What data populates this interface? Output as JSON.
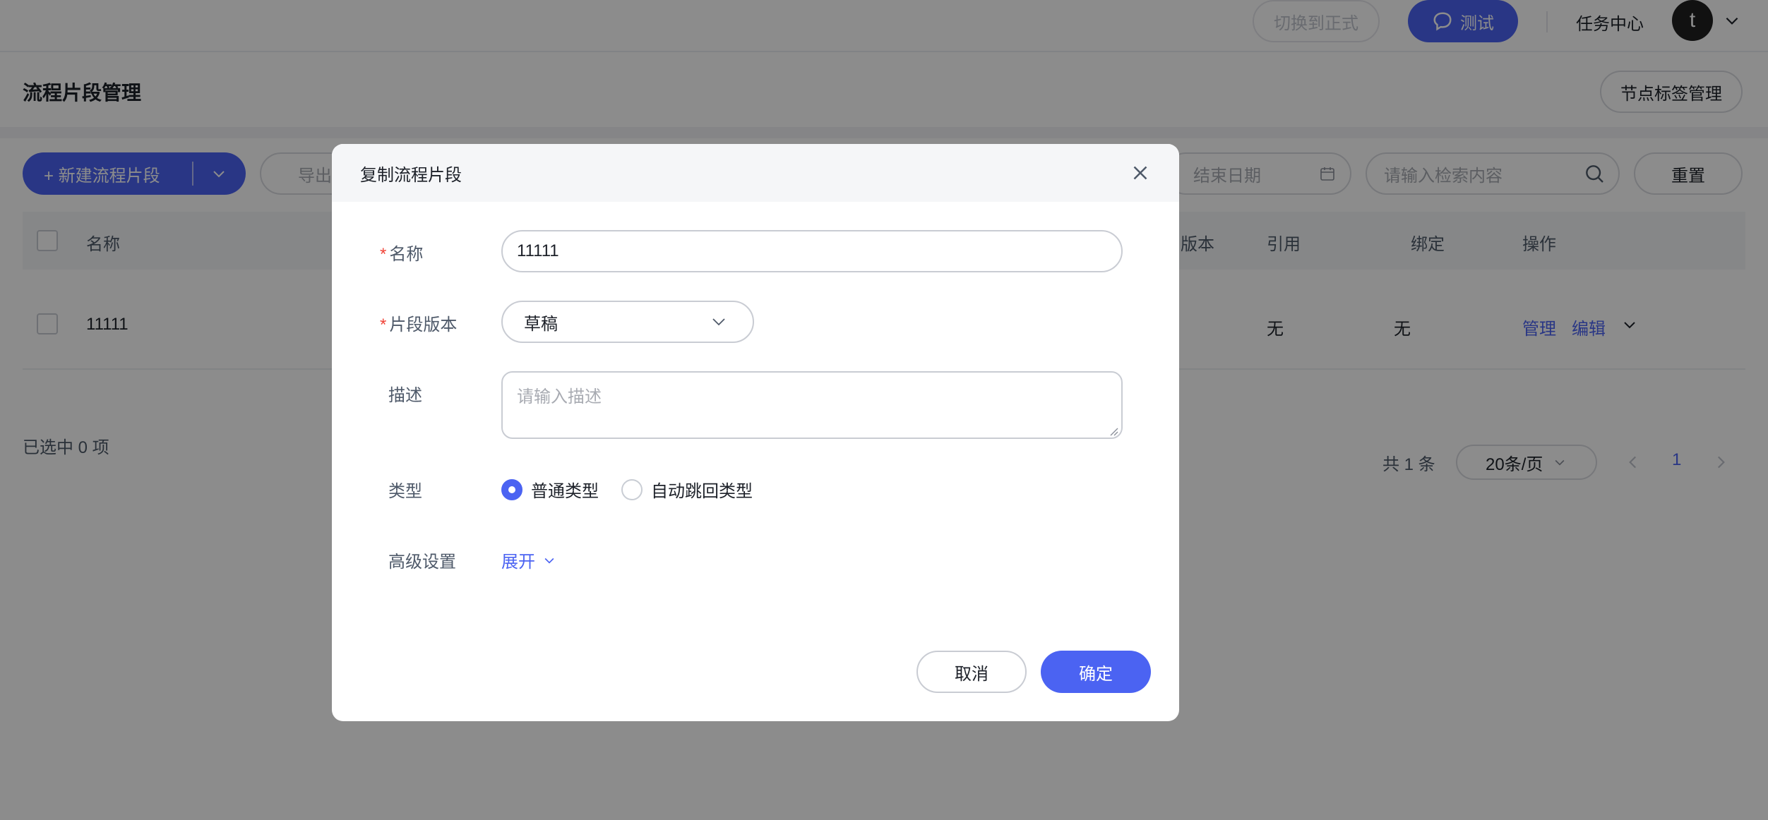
{
  "topbar": {
    "switch_label": "切换到正式",
    "test_label": "测试",
    "task_center": "任务中心",
    "avatar_letter": "t"
  },
  "header": {
    "title": "流程片段管理",
    "tag_manage_label": "节点标签管理"
  },
  "toolbar": {
    "new_label": "+ 新建流程片段",
    "export_label": "导出",
    "end_date_placeholder": "结束日期",
    "search_placeholder": "请输入检索内容",
    "reset_label": "重置"
  },
  "table": {
    "columns": [
      "名称",
      "版本",
      "引用",
      "绑定",
      "操作"
    ],
    "rows": [
      {
        "name": "11111",
        "ref": "无",
        "bind": "无",
        "actions": [
          "管理",
          "编辑"
        ]
      }
    ]
  },
  "footer": {
    "selected": "已选中 0 项",
    "total": "共 1 条",
    "page_size": "20条/页",
    "page": "1"
  },
  "modal": {
    "title": "复制流程片段",
    "fields": {
      "name_label": "名称",
      "name_value": "11111",
      "version_label": "片段版本",
      "version_value": "草稿",
      "desc_label": "描述",
      "desc_placeholder": "请输入描述",
      "type_label": "类型",
      "type_options": [
        "普通类型",
        "自动跳回类型"
      ],
      "advanced_label": "高级设置",
      "expand_label": "展开"
    },
    "cancel_label": "取消",
    "ok_label": "确定"
  },
  "colors": {
    "primary": "#4b63f2",
    "required": "#f04438"
  }
}
